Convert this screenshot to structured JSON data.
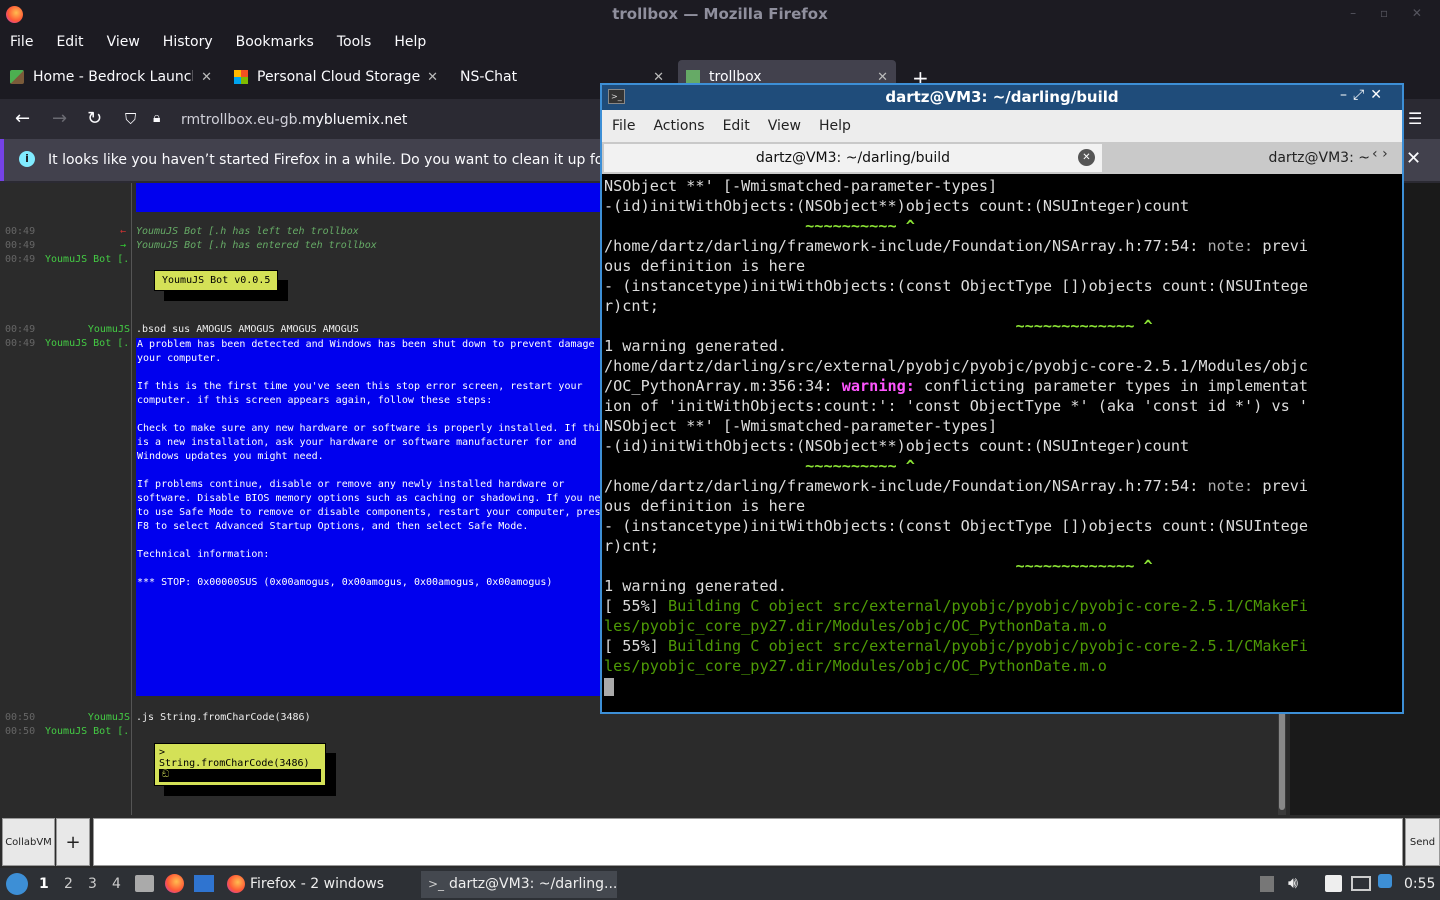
{
  "firefox": {
    "window_title": "trollbox — Mozilla Firefox",
    "menu": [
      "File",
      "Edit",
      "View",
      "History",
      "Bookmarks",
      "Tools",
      "Help"
    ],
    "tabs": [
      {
        "label": "Home - Bedrock Launcher"
      },
      {
        "label": "Personal Cloud Storage -"
      },
      {
        "label": "NS-Chat"
      },
      {
        "label": "trollbox"
      }
    ],
    "url_prefix": "rmtrollbox.eu-gb.",
    "url_domain": "mybluemix.net",
    "notice": "It looks like you haven’t started Firefox in a while. Do you want to clean it up for a fresh, like-new experience?"
  },
  "chat": {
    "lines": [
      {
        "time": "00:49",
        "nick": "",
        "text": "YoumuJS Bot [.h has left teh trollbox",
        "type": "sys-left"
      },
      {
        "time": "00:49",
        "nick": "",
        "text": "YoumuJS Bot [.h has entered teh trollbox",
        "type": "sys-enter"
      },
      {
        "time": "00:49",
        "nick": "YoumuJS Bot [.h",
        "text": ""
      },
      {
        "time": "00:49",
        "nick": "YoumuJS",
        "text": ".bsod sus AMOGUS AMOGUS AMOGUS AMOGUS"
      },
      {
        "time": "00:49",
        "nick": "YoumuJS Bot [.h",
        "text": ""
      },
      {
        "time": "00:50",
        "nick": "YoumuJS",
        "text": ".js String.fromCharCode(3486)"
      },
      {
        "time": "00:50",
        "nick": "YoumuJS Bot [.h",
        "text": ""
      }
    ],
    "bot_version": "YoumuJS Bot v0.0.5",
    "js_result_line1": "> String.fromCharCode(3486)",
    "js_result_line2": "ඞ",
    "bsod": [
      "A problem has been detected and Windows has been shut down to prevent damage to",
      "your computer.",
      "",
      "If this is the first time you've seen this stop error screen, restart your",
      "computer. if this screen appears again, follow these steps:",
      "",
      "Check to make sure any new hardware or software is properly installed. If this",
      "is a new installation, ask your hardware or software manufacturer for and",
      "Windows updates you might need.",
      "",
      "If problems continue, disable or remove any newly installed hardware or",
      "software. Disable BIOS memory options such as caching or shadowing. If you need",
      "to use Safe Mode to remove or disable components, restart your computer, press",
      "F8 to select Advanced Startup Options, and then select Safe Mode.",
      "",
      "Technical information:",
      "",
      "*** STOP: 0x00000SUS (0x00amogus, 0x00amogus, 0x00amogus, 0x00amogus)"
    ],
    "collabvm_label": "CollabVM",
    "plus_label": "+",
    "send_label": "Send"
  },
  "terminal": {
    "title": "dartz@VM3: ~/darling/build",
    "menu": [
      "File",
      "Actions",
      "Edit",
      "View",
      "Help"
    ],
    "tab1": "dartz@VM3: ~/darling/build",
    "tab2": "dartz@VM3: ~",
    "output": [
      [
        {
          "t": "NSObject **' [-Wmismatched-parameter-types]",
          "c": "b"
        }
      ],
      [
        {
          "t": "-(id)initWithObjects:(NSObject**)objects count:(NSUInteger)count",
          "c": ""
        }
      ],
      [
        {
          "t": "                      ~~~~~~~~~~ ^",
          "c": "bg"
        }
      ],
      [
        {
          "t": "/home/dartz/darling/framework-include/Foundation/NSArray.h:77:54: ",
          "c": "b"
        },
        {
          "t": "note: ",
          "c": "n"
        },
        {
          "t": "previ",
          "c": ""
        }
      ],
      [
        {
          "t": "ous definition is here",
          "c": ""
        }
      ],
      [
        {
          "t": "- (instancetype)initWithObjects:(const ObjectType [])objects count:(NSUIntege",
          "c": ""
        }
      ],
      [
        {
          "t": "r)cnt;",
          "c": ""
        }
      ],
      [
        {
          "t": "                                             ~~~~~~~~~~~~~ ^",
          "c": "bg"
        }
      ],
      [
        {
          "t": "1 warning generated.",
          "c": ""
        }
      ],
      [
        {
          "t": "/home/dartz/darling/src/external/pyobjc/pyobjc/pyobjc-core-2.5.1/Modules/objc",
          "c": "b"
        }
      ],
      [
        {
          "t": "/OC_PythonArray.m:356:34: ",
          "c": "b"
        },
        {
          "t": "warning: ",
          "c": "m"
        },
        {
          "t": "conflicting parameter types in implementat",
          "c": "b"
        }
      ],
      [
        {
          "t": "ion of 'initWithObjects:count:': 'const ObjectType *' (aka 'const id *') vs '",
          "c": "b"
        }
      ],
      [
        {
          "t": "NSObject **' [-Wmismatched-parameter-types]",
          "c": "b"
        }
      ],
      [
        {
          "t": "-(id)initWithObjects:(NSObject**)objects count:(NSUInteger)count",
          "c": ""
        }
      ],
      [
        {
          "t": "                      ~~~~~~~~~~ ^",
          "c": "bg"
        }
      ],
      [
        {
          "t": "/home/dartz/darling/framework-include/Foundation/NSArray.h:77:54: ",
          "c": "b"
        },
        {
          "t": "note: ",
          "c": "n"
        },
        {
          "t": "previ",
          "c": ""
        }
      ],
      [
        {
          "t": "ous definition is here",
          "c": ""
        }
      ],
      [
        {
          "t": "- (instancetype)initWithObjects:(const ObjectType [])objects count:(NSUIntege",
          "c": ""
        }
      ],
      [
        {
          "t": "r)cnt;",
          "c": ""
        }
      ],
      [
        {
          "t": "                                             ~~~~~~~~~~~~~ ^",
          "c": "bg"
        }
      ],
      [
        {
          "t": "1 warning generated.",
          "c": ""
        }
      ],
      [
        {
          "t": "[ 55%] ",
          "c": ""
        },
        {
          "t": "Building C object src/external/pyobjc/pyobjc/pyobjc-core-2.5.1/CMakeFi",
          "c": "g"
        }
      ],
      [
        {
          "t": "les/pyobjc_core_py27.dir/Modules/objc/OC_PythonData.m.o",
          "c": "g"
        }
      ],
      [
        {
          "t": "[ 55%] ",
          "c": ""
        },
        {
          "t": "Building C object src/external/pyobjc/pyobjc/pyobjc-core-2.5.1/CMakeFi",
          "c": "g"
        }
      ],
      [
        {
          "t": "les/pyobjc_core_py27.dir/Modules/objc/OC_PythonDate.m.o",
          "c": "g"
        }
      ]
    ]
  },
  "taskbar": {
    "workspaces": [
      "1",
      "2",
      "3",
      "4"
    ],
    "firefox_task": "Firefox - 2 windows",
    "terminal_task": "dartz@VM3: ~/darling...",
    "clock": "0:55"
  },
  "colors": {
    "accent": "#3d8fd6",
    "bsod": "#0000ee",
    "bot_box": "#d4e157"
  }
}
